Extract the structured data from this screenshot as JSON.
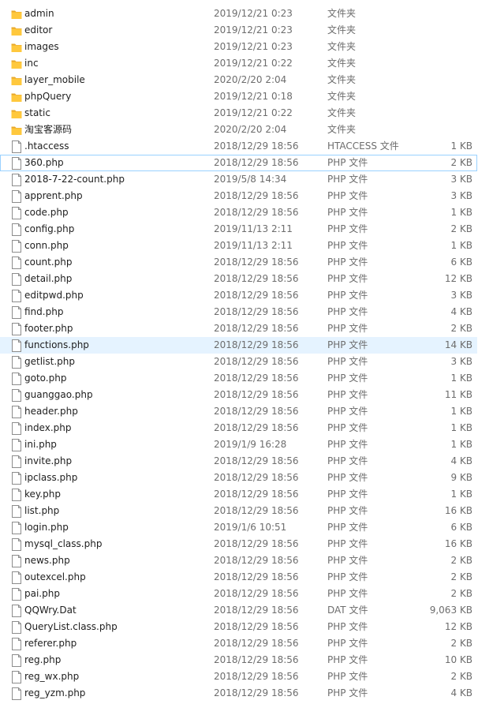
{
  "colors": {
    "folder": "#ffc83d",
    "folder_dark": "#e8a82a",
    "file_border": "#8c8c8c",
    "hover_bg": "#e5f3ff",
    "focus_border": "#99d1ff",
    "meta_text": "#6d6d6d"
  },
  "files": [
    {
      "name": "admin",
      "date": "2019/12/21 0:23",
      "type": "文件夹",
      "size": "",
      "icon": "folder-icon"
    },
    {
      "name": "editor",
      "date": "2019/12/21 0:23",
      "type": "文件夹",
      "size": "",
      "icon": "folder-icon"
    },
    {
      "name": "images",
      "date": "2019/12/21 0:23",
      "type": "文件夹",
      "size": "",
      "icon": "folder-icon"
    },
    {
      "name": "inc",
      "date": "2019/12/21 0:22",
      "type": "文件夹",
      "size": "",
      "icon": "folder-icon"
    },
    {
      "name": "layer_mobile",
      "date": "2020/2/20 2:04",
      "type": "文件夹",
      "size": "",
      "icon": "folder-icon"
    },
    {
      "name": "phpQuery",
      "date": "2019/12/21 0:18",
      "type": "文件夹",
      "size": "",
      "icon": "folder-icon"
    },
    {
      "name": "static",
      "date": "2019/12/21 0:22",
      "type": "文件夹",
      "size": "",
      "icon": "folder-icon"
    },
    {
      "name": "淘宝客源码",
      "date": "2020/2/20 2:04",
      "type": "文件夹",
      "size": "",
      "icon": "folder-icon"
    },
    {
      "name": ".htaccess",
      "date": "2018/12/29 18:56",
      "type": "HTACCESS 文件",
      "size": "1 KB",
      "icon": "file-icon"
    },
    {
      "name": "360.php",
      "date": "2018/12/29 18:56",
      "type": "PHP 文件",
      "size": "2 KB",
      "icon": "file-icon",
      "state": "focused"
    },
    {
      "name": "2018-7-22-count.php",
      "date": "2019/5/8 14:34",
      "type": "PHP 文件",
      "size": "3 KB",
      "icon": "file-icon"
    },
    {
      "name": "apprent.php",
      "date": "2018/12/29 18:56",
      "type": "PHP 文件",
      "size": "3 KB",
      "icon": "file-icon"
    },
    {
      "name": "code.php",
      "date": "2018/12/29 18:56",
      "type": "PHP 文件",
      "size": "1 KB",
      "icon": "file-icon"
    },
    {
      "name": "config.php",
      "date": "2019/11/13 2:11",
      "type": "PHP 文件",
      "size": "2 KB",
      "icon": "file-icon"
    },
    {
      "name": "conn.php",
      "date": "2019/11/13 2:11",
      "type": "PHP 文件",
      "size": "1 KB",
      "icon": "file-icon"
    },
    {
      "name": "count.php",
      "date": "2018/12/29 18:56",
      "type": "PHP 文件",
      "size": "6 KB",
      "icon": "file-icon"
    },
    {
      "name": "detail.php",
      "date": "2018/12/29 18:56",
      "type": "PHP 文件",
      "size": "12 KB",
      "icon": "file-icon"
    },
    {
      "name": "editpwd.php",
      "date": "2018/12/29 18:56",
      "type": "PHP 文件",
      "size": "3 KB",
      "icon": "file-icon"
    },
    {
      "name": "find.php",
      "date": "2018/12/29 18:56",
      "type": "PHP 文件",
      "size": "4 KB",
      "icon": "file-icon"
    },
    {
      "name": "footer.php",
      "date": "2018/12/29 18:56",
      "type": "PHP 文件",
      "size": "2 KB",
      "icon": "file-icon"
    },
    {
      "name": "functions.php",
      "date": "2018/12/29 18:56",
      "type": "PHP 文件",
      "size": "14 KB",
      "icon": "file-icon",
      "state": "hovered"
    },
    {
      "name": "getlist.php",
      "date": "2018/12/29 18:56",
      "type": "PHP 文件",
      "size": "3 KB",
      "icon": "file-icon"
    },
    {
      "name": "goto.php",
      "date": "2018/12/29 18:56",
      "type": "PHP 文件",
      "size": "1 KB",
      "icon": "file-icon"
    },
    {
      "name": "guanggao.php",
      "date": "2018/12/29 18:56",
      "type": "PHP 文件",
      "size": "11 KB",
      "icon": "file-icon"
    },
    {
      "name": "header.php",
      "date": "2018/12/29 18:56",
      "type": "PHP 文件",
      "size": "1 KB",
      "icon": "file-icon"
    },
    {
      "name": "index.php",
      "date": "2018/12/29 18:56",
      "type": "PHP 文件",
      "size": "1 KB",
      "icon": "file-icon"
    },
    {
      "name": "ini.php",
      "date": "2019/1/9 16:28",
      "type": "PHP 文件",
      "size": "1 KB",
      "icon": "file-icon"
    },
    {
      "name": "invite.php",
      "date": "2018/12/29 18:56",
      "type": "PHP 文件",
      "size": "4 KB",
      "icon": "file-icon"
    },
    {
      "name": "ipclass.php",
      "date": "2018/12/29 18:56",
      "type": "PHP 文件",
      "size": "9 KB",
      "icon": "file-icon"
    },
    {
      "name": "key.php",
      "date": "2018/12/29 18:56",
      "type": "PHP 文件",
      "size": "1 KB",
      "icon": "file-icon"
    },
    {
      "name": "list.php",
      "date": "2018/12/29 18:56",
      "type": "PHP 文件",
      "size": "16 KB",
      "icon": "file-icon"
    },
    {
      "name": "login.php",
      "date": "2019/1/6 10:51",
      "type": "PHP 文件",
      "size": "6 KB",
      "icon": "file-icon"
    },
    {
      "name": "mysql_class.php",
      "date": "2018/12/29 18:56",
      "type": "PHP 文件",
      "size": "16 KB",
      "icon": "file-icon"
    },
    {
      "name": "news.php",
      "date": "2018/12/29 18:56",
      "type": "PHP 文件",
      "size": "2 KB",
      "icon": "file-icon"
    },
    {
      "name": "outexcel.php",
      "date": "2018/12/29 18:56",
      "type": "PHP 文件",
      "size": "2 KB",
      "icon": "file-icon"
    },
    {
      "name": "pai.php",
      "date": "2018/12/29 18:56",
      "type": "PHP 文件",
      "size": "2 KB",
      "icon": "file-icon"
    },
    {
      "name": "QQWry.Dat",
      "date": "2018/12/29 18:56",
      "type": "DAT 文件",
      "size": "9,063 KB",
      "icon": "file-icon"
    },
    {
      "name": "QueryList.class.php",
      "date": "2018/12/29 18:56",
      "type": "PHP 文件",
      "size": "12 KB",
      "icon": "file-icon"
    },
    {
      "name": "referer.php",
      "date": "2018/12/29 18:56",
      "type": "PHP 文件",
      "size": "2 KB",
      "icon": "file-icon"
    },
    {
      "name": "reg.php",
      "date": "2018/12/29 18:56",
      "type": "PHP 文件",
      "size": "10 KB",
      "icon": "file-icon"
    },
    {
      "name": "reg_wx.php",
      "date": "2018/12/29 18:56",
      "type": "PHP 文件",
      "size": "2 KB",
      "icon": "file-icon"
    },
    {
      "name": "reg_yzm.php",
      "date": "2018/12/29 18:56",
      "type": "PHP 文件",
      "size": "4 KB",
      "icon": "file-icon"
    }
  ]
}
